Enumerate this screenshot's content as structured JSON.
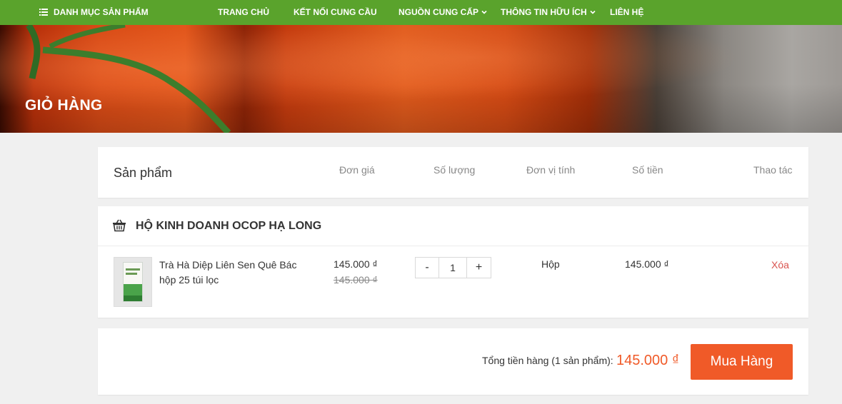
{
  "nav": {
    "category": "DANH MỤC SẢN PHẨM",
    "home": "TRANG CHỦ",
    "connect": "KẾT NỐI CUNG CẦU",
    "supply": "NGUỒN CUNG CẤP",
    "info": "THÔNG TIN HỮU ÍCH",
    "contact": "LIÊN HỆ"
  },
  "hero": {
    "title": "GIỎ HÀNG"
  },
  "table_header": {
    "product": "Sản phẩm",
    "unit_price": "Đơn giá",
    "quantity": "Số lượng",
    "unit": "Đơn vị tính",
    "amount": "Số tiền",
    "actions": "Thao tác"
  },
  "shop": {
    "name": "HỘ KINH DOANH OCOP HẠ LONG",
    "items": [
      {
        "name": "Trà Hà Diệp Liên Sen Quê Bác hộp 25 túi lọc",
        "price": "145.000 ₫",
        "old_price": "145.000 ₫",
        "quantity": "1",
        "unit": "Hộp",
        "amount": "145.000 ₫",
        "delete_label": "Xóa",
        "minus_label": "-",
        "plus_label": "+"
      }
    ]
  },
  "summary": {
    "label": "Tổng tiền hàng (1 sản phẩm):",
    "total": "145.000 ₫",
    "buy_label": "Mua Hàng"
  },
  "colors": {
    "nav_bg": "#5aa32c",
    "accent": "#f05a28",
    "delete": "#d9534f",
    "page_bg": "#f0f0f0"
  },
  "icons": [
    "menu-icon",
    "chevron-down-icon",
    "basket-icon",
    "product-image"
  ]
}
